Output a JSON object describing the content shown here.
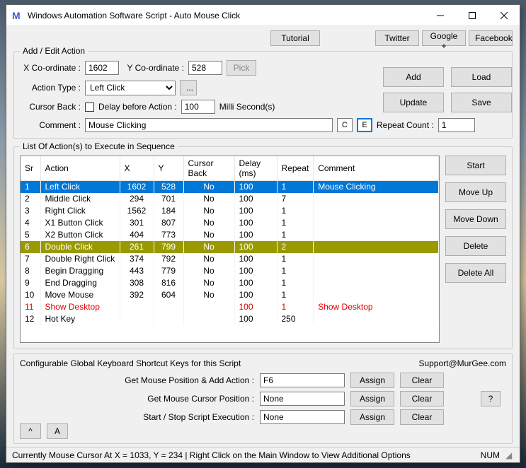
{
  "window": {
    "title": "Windows Automation Software Script - Auto Mouse Click"
  },
  "toplinks": {
    "tutorial": "Tutorial",
    "twitter": "Twitter",
    "google": "Google +",
    "facebook": "Facebook"
  },
  "edit": {
    "legend": "Add / Edit Action",
    "xlabel": "X Co-ordinate :",
    "xval": "1602",
    "ylabel": "Y Co-ordinate :",
    "yval": "528",
    "pick": "Pick",
    "atlabel": "Action Type :",
    "atval": "Left Click",
    "atmore": "...",
    "cblabel": "Cursor Back :",
    "dlabel": "Delay before Action :",
    "dval": "100",
    "dunit": "Milli Second(s)",
    "clabel": "Comment :",
    "cval": "Mouse Clicking",
    "cbtn": "C",
    "ebtn": "E",
    "rclabel": "Repeat Count :",
    "rcval": "1"
  },
  "btns": {
    "add": "Add",
    "load": "Load",
    "update": "Update",
    "save": "Save",
    "start": "Start",
    "moveup": "Move Up",
    "movedown": "Move Down",
    "delete": "Delete",
    "deleteall": "Delete All"
  },
  "list": {
    "legend": "List Of Action(s) to Execute in Sequence",
    "cols": {
      "sr": "Sr",
      "action": "Action",
      "x": "X",
      "y": "Y",
      "cb": "Cursor Back",
      "delay": "Delay (ms)",
      "repeat": "Repeat",
      "comment": "Comment"
    },
    "rows": [
      {
        "sr": "1",
        "action": "Left Click",
        "x": "1602",
        "y": "528",
        "cb": "No",
        "delay": "100",
        "repeat": "1",
        "comment": "Mouse Clicking",
        "cls": "sel"
      },
      {
        "sr": "2",
        "action": "Middle Click",
        "x": "294",
        "y": "701",
        "cb": "No",
        "delay": "100",
        "repeat": "7",
        "comment": "",
        "cls": ""
      },
      {
        "sr": "3",
        "action": "Right Click",
        "x": "1562",
        "y": "184",
        "cb": "No",
        "delay": "100",
        "repeat": "1",
        "comment": "",
        "cls": ""
      },
      {
        "sr": "4",
        "action": "X1 Button Click",
        "x": "301",
        "y": "807",
        "cb": "No",
        "delay": "100",
        "repeat": "1",
        "comment": "",
        "cls": ""
      },
      {
        "sr": "5",
        "action": "X2 Button Click",
        "x": "404",
        "y": "773",
        "cb": "No",
        "delay": "100",
        "repeat": "1",
        "comment": "",
        "cls": ""
      },
      {
        "sr": "6",
        "action": "Double Click",
        "x": "261",
        "y": "799",
        "cb": "No",
        "delay": "100",
        "repeat": "2",
        "comment": "",
        "cls": "hl"
      },
      {
        "sr": "7",
        "action": "Double Right Click",
        "x": "374",
        "y": "792",
        "cb": "No",
        "delay": "100",
        "repeat": "1",
        "comment": "",
        "cls": ""
      },
      {
        "sr": "8",
        "action": "Begin Dragging",
        "x": "443",
        "y": "779",
        "cb": "No",
        "delay": "100",
        "repeat": "1",
        "comment": "",
        "cls": ""
      },
      {
        "sr": "9",
        "action": "End Dragging",
        "x": "308",
        "y": "816",
        "cb": "No",
        "delay": "100",
        "repeat": "1",
        "comment": "",
        "cls": ""
      },
      {
        "sr": "10",
        "action": "Move Mouse",
        "x": "392",
        "y": "604",
        "cb": "No",
        "delay": "100",
        "repeat": "1",
        "comment": "",
        "cls": ""
      },
      {
        "sr": "11",
        "action": "Show Desktop",
        "x": "",
        "y": "",
        "cb": "",
        "delay": "100",
        "repeat": "1",
        "comment": "Show Desktop",
        "cls": "red"
      },
      {
        "sr": "12",
        "action": "Hot Key",
        "x": "",
        "y": "",
        "cb": "",
        "delay": "100",
        "repeat": "250",
        "comment": "",
        "cls": ""
      }
    ]
  },
  "hotkeys": {
    "legend": "Configurable Global Keyboard Shortcut Keys for this Script",
    "support": "Support@MurGee.com",
    "r1": {
      "label": "Get Mouse Position & Add Action :",
      "val": "F6"
    },
    "r2": {
      "label": "Get Mouse Cursor Position :",
      "val": "None"
    },
    "r3": {
      "label": "Start / Stop Script Execution :",
      "val": "None"
    },
    "assign": "Assign",
    "clear": "Clear",
    "q": "?"
  },
  "footer": {
    "up": "^",
    "a": "A"
  },
  "status": {
    "text": "Currently Mouse Cursor At X = 1033, Y = 234 | Right Click on the Main Window to View Additional Options",
    "num": "NUM"
  }
}
